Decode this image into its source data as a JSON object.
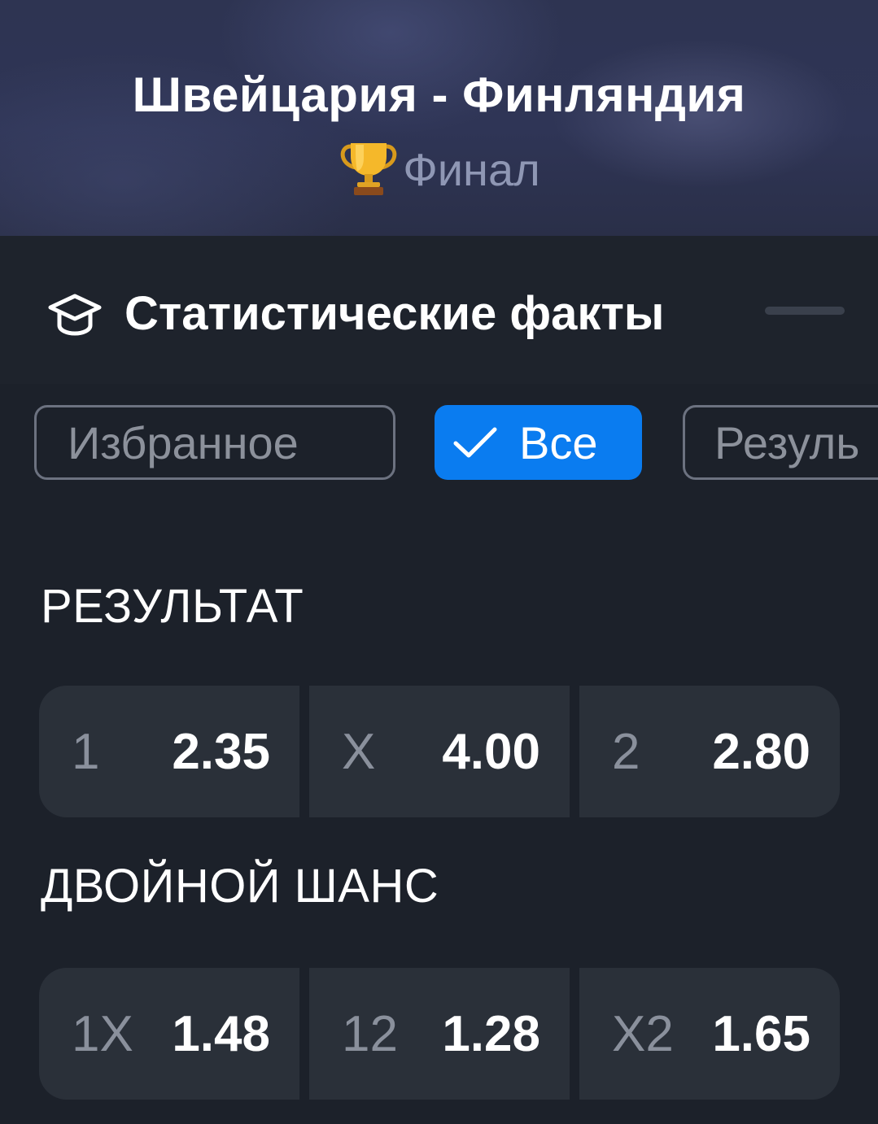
{
  "match": {
    "title": "Швейцария - Финляндия",
    "stage": "Финал"
  },
  "stats": {
    "title": "Статистические факты"
  },
  "filters": [
    {
      "label": "Избранное",
      "active": false
    },
    {
      "label": "Все",
      "active": true
    },
    {
      "label": "Резуль",
      "active": false
    }
  ],
  "markets": [
    {
      "title": "РЕЗУЛЬТАТ",
      "odds": [
        {
          "label": "1",
          "value": "2.35"
        },
        {
          "label": "X",
          "value": "4.00"
        },
        {
          "label": "2",
          "value": "2.80"
        }
      ]
    },
    {
      "title": "ДВОЙНОЙ ШАНС",
      "odds": [
        {
          "label": "1X",
          "value": "1.48"
        },
        {
          "label": "12",
          "value": "1.28"
        },
        {
          "label": "X2",
          "value": "1.65"
        }
      ]
    }
  ],
  "colors": {
    "accent": "#0a7cf0",
    "background": "#1c212a",
    "odd_cell": "#2a3039"
  },
  "icons": {
    "stage": "trophy-icon",
    "stats": "graduation-cap-icon",
    "active_filter": "checkmark-icon"
  }
}
